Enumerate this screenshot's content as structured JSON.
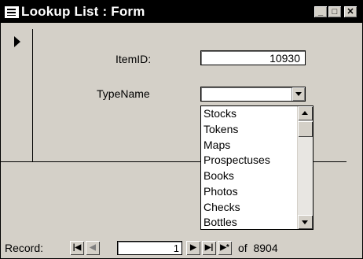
{
  "window": {
    "title": "Lookup List : Form"
  },
  "fields": {
    "item_id_label": "ItemID:",
    "item_id_value": "10930",
    "type_name_label": "TypeName",
    "type_name_value": ""
  },
  "dropdown": {
    "items": [
      "Stocks",
      "Tokens",
      "Maps",
      "Prospectuses",
      "Books",
      "Photos",
      "Checks",
      "Bottles"
    ]
  },
  "navigation": {
    "record_label": "Record:",
    "current_record": "1",
    "total_text": "of  8904",
    "first_glyph": "|◀",
    "prev_glyph": "◀",
    "next_glyph": "▶",
    "last_glyph": "▶|",
    "new_glyph": "▶*"
  },
  "title_buttons": {
    "minimize": "_",
    "maximize": "□",
    "close": "✕"
  },
  "colors": {
    "face": "#d4d0c8",
    "titlebar": "#000000"
  }
}
